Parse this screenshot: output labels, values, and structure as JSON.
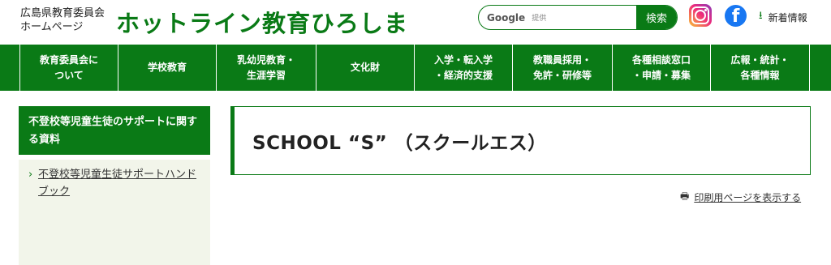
{
  "header": {
    "board_name_line1": "広島県教育委員会",
    "board_name_line2": "ホームページ",
    "site_title": "ホットライン教育ひろしま",
    "search": {
      "brand": "Google",
      "sub": "提供",
      "button": "検索"
    },
    "social": {
      "instagram": "instagram-icon",
      "facebook": "facebook-icon"
    },
    "news_label": "新着情報"
  },
  "gnav": [
    {
      "line1": "教育委員会に",
      "line2": "ついて"
    },
    {
      "line1": "学校教育",
      "line2": ""
    },
    {
      "line1": "乳幼児教育・",
      "line2": "生涯学習"
    },
    {
      "line1": "文化財",
      "line2": ""
    },
    {
      "line1": "入学・転入学",
      "line2": "・経済的支援"
    },
    {
      "line1": "教職員採用・",
      "line2": "免許・研修等"
    },
    {
      "line1": "各種相談窓口",
      "line2": "・申請・募集"
    },
    {
      "line1": "広報・統計・",
      "line2": "各種情報"
    }
  ],
  "sidebar": {
    "heading": "不登校等児童生徒のサポートに関する資料",
    "links": [
      {
        "label": "不登校等児童生徒サポートハンドブック"
      }
    ]
  },
  "main": {
    "title": "SCHOOL “S” （スクールエス）",
    "print_label": "印刷用ページを表示する"
  },
  "colors": {
    "brand_green": "#0a7a16",
    "sidebar_bg": "#f2f5ea"
  }
}
